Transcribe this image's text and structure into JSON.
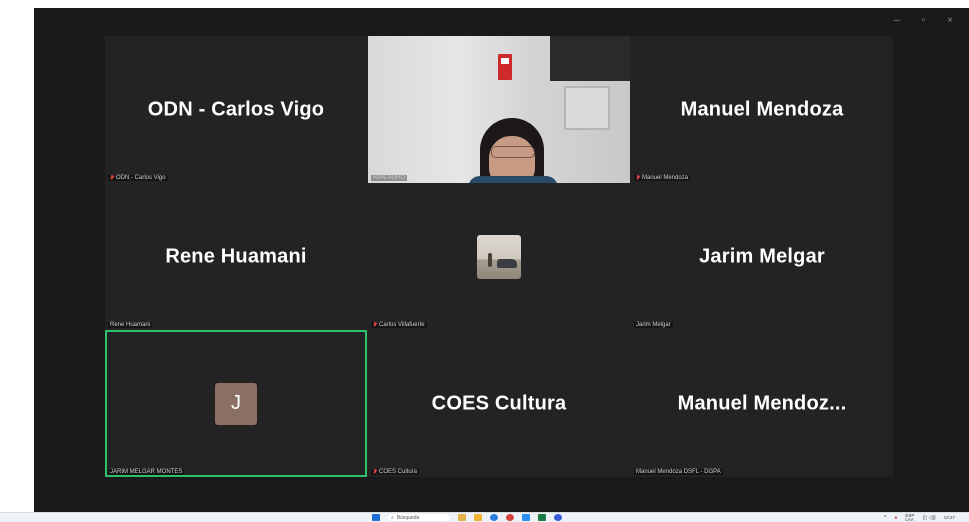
{
  "window": {
    "controls": {
      "minimize": "–",
      "restore": "▫",
      "close": "×"
    }
  },
  "tiles": [
    {
      "display_name": "ODN - Carlos Vigo",
      "tag": "ODN - Carlos Vigo",
      "muted": true
    },
    {
      "display_name": "",
      "tag": "RAN.AGRO",
      "muted": false
    },
    {
      "display_name": "Manuel Mendoza",
      "tag": "Manuel Mendoza",
      "muted": true
    },
    {
      "display_name": "Rene Huamani",
      "tag": "Rene Huamani",
      "muted": false
    },
    {
      "display_name": "",
      "tag": "Carlos Villafuerte",
      "muted": true
    },
    {
      "display_name": "Jarim Melgar",
      "tag": "Jarim Melgar",
      "muted": false
    },
    {
      "display_name": "",
      "avatar_letter": "J",
      "tag": "JARIM MELGAR MONTES",
      "muted": false
    },
    {
      "display_name": "COES Cultura",
      "tag": "COES Cultura",
      "muted": true
    },
    {
      "display_name": "Manuel  Mendoz...",
      "tag": "Manuel Mendoza DSFL - DGPA",
      "muted": false
    }
  ],
  "taskbar": {
    "search_placeholder": "Búsqueda",
    "language": "ESP",
    "language_sub": "LAA",
    "time": "12:27",
    "date": ""
  },
  "colors": {
    "background": "#1a1a1a",
    "tile": "#232323",
    "active_speaker": "#2fbf6a",
    "avatar": "#8a6f65",
    "muted_mic": "#e0443e"
  }
}
